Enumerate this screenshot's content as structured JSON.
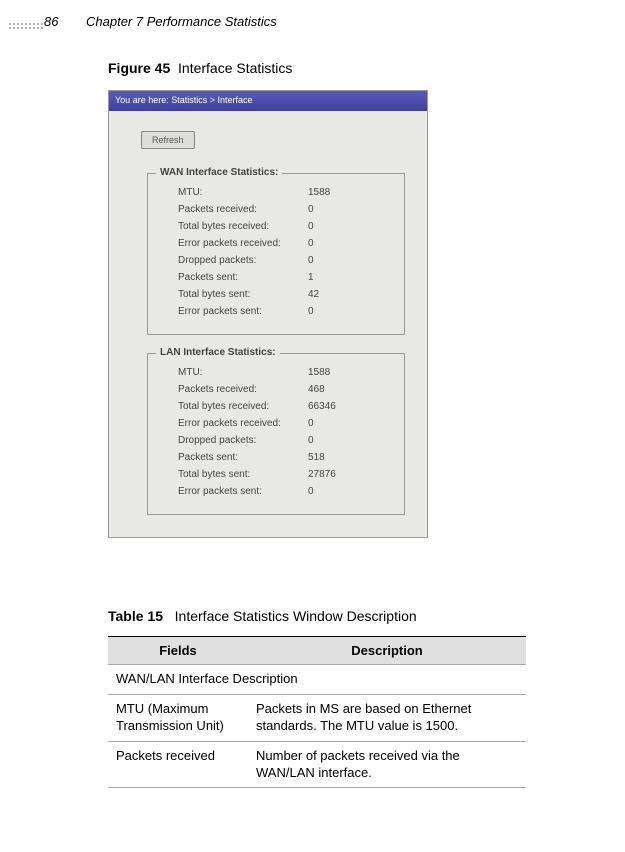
{
  "page": {
    "number": "86",
    "chapter": "Chapter 7 Performance Statistics"
  },
  "figure": {
    "label": "Figure 45",
    "title": "Interface Statistics"
  },
  "screenshot": {
    "titlebar": "You are here:  Statistics > Interface",
    "refresh": "Refresh",
    "wan": {
      "legend": "WAN Interface Statistics:",
      "rows": [
        {
          "label": "MTU:",
          "value": "1588"
        },
        {
          "label": "Packets received:",
          "value": "0"
        },
        {
          "label": "Total bytes received:",
          "value": "0"
        },
        {
          "label": "Error packets received:",
          "value": "0"
        },
        {
          "label": "Dropped packets:",
          "value": "0"
        },
        {
          "label": "Packets sent:",
          "value": "1"
        },
        {
          "label": "Total bytes sent:",
          "value": "42"
        },
        {
          "label": "Error packets sent:",
          "value": "0"
        }
      ]
    },
    "lan": {
      "legend": "LAN Interface Statistics:",
      "rows": [
        {
          "label": "MTU:",
          "value": "1588"
        },
        {
          "label": "Packets received:",
          "value": "468"
        },
        {
          "label": "Total bytes received:",
          "value": "66346"
        },
        {
          "label": "Error packets received:",
          "value": "0"
        },
        {
          "label": "Dropped packets:",
          "value": "0"
        },
        {
          "label": "Packets sent:",
          "value": "518"
        },
        {
          "label": "Total bytes sent:",
          "value": "27876"
        },
        {
          "label": "Error packets sent:",
          "value": "0"
        }
      ]
    }
  },
  "table": {
    "label": "Table 15",
    "title": "Interface Statistics Window Description",
    "headers": {
      "fields": "Fields",
      "description": "Description"
    },
    "section": "WAN/LAN Interface Description",
    "rows": [
      {
        "field": "MTU (Maximum Transmission Unit)",
        "desc": "Packets in MS are based on Ethernet standards. The MTU value is 1500."
      },
      {
        "field": "Packets received",
        "desc": "Number of packets received via the WAN/LAN interface."
      }
    ]
  }
}
